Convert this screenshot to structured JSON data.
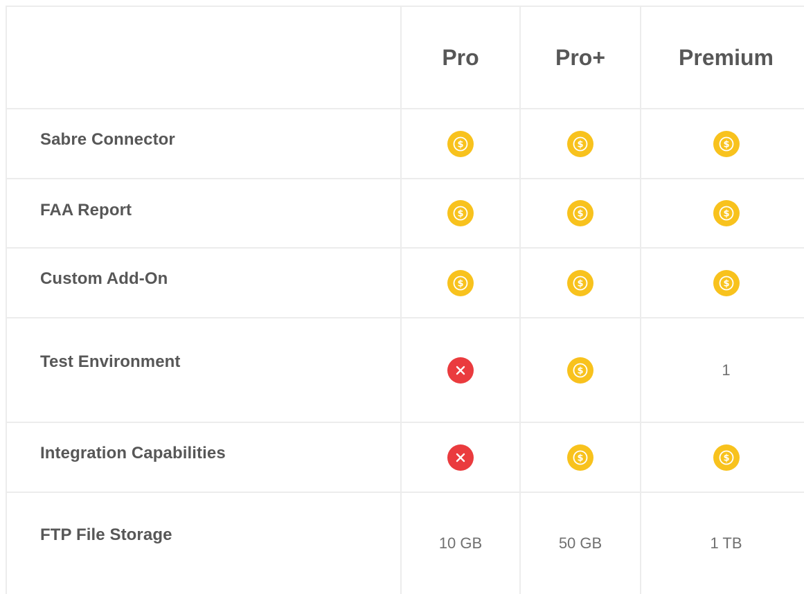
{
  "columns": [
    "Pro",
    "Pro+",
    "Premium"
  ],
  "rows": [
    {
      "feature": "Sabre Connector",
      "values": [
        {
          "type": "icon",
          "icon": "dollar-coin-icon"
        },
        {
          "type": "icon",
          "icon": "dollar-coin-icon"
        },
        {
          "type": "icon",
          "icon": "dollar-coin-icon"
        }
      ]
    },
    {
      "feature": "FAA Report",
      "values": [
        {
          "type": "icon",
          "icon": "dollar-coin-icon"
        },
        {
          "type": "icon",
          "icon": "dollar-coin-icon"
        },
        {
          "type": "icon",
          "icon": "dollar-coin-icon"
        }
      ]
    },
    {
      "feature": "Custom Add-On",
      "values": [
        {
          "type": "icon",
          "icon": "dollar-coin-icon"
        },
        {
          "type": "icon",
          "icon": "dollar-coin-icon"
        },
        {
          "type": "icon",
          "icon": "dollar-coin-icon"
        }
      ]
    },
    {
      "feature": "Test Environment",
      "values": [
        {
          "type": "icon",
          "icon": "x-circle-icon"
        },
        {
          "type": "icon",
          "icon": "dollar-coin-icon"
        },
        {
          "type": "text",
          "text": "1"
        }
      ]
    },
    {
      "feature": "Integration Capabilities",
      "values": [
        {
          "type": "icon",
          "icon": "x-circle-icon"
        },
        {
          "type": "icon",
          "icon": "dollar-coin-icon"
        },
        {
          "type": "icon",
          "icon": "dollar-coin-icon"
        }
      ]
    },
    {
      "feature": "FTP File Storage",
      "values": [
        {
          "type": "text",
          "text": "10 GB"
        },
        {
          "type": "text",
          "text": "50 GB"
        },
        {
          "type": "text",
          "text": "1 TB"
        }
      ]
    }
  ],
  "colors": {
    "coin": "#f8c21d",
    "x": "#ea3b3e",
    "grid_line": "#ececec",
    "text": "#575757"
  }
}
